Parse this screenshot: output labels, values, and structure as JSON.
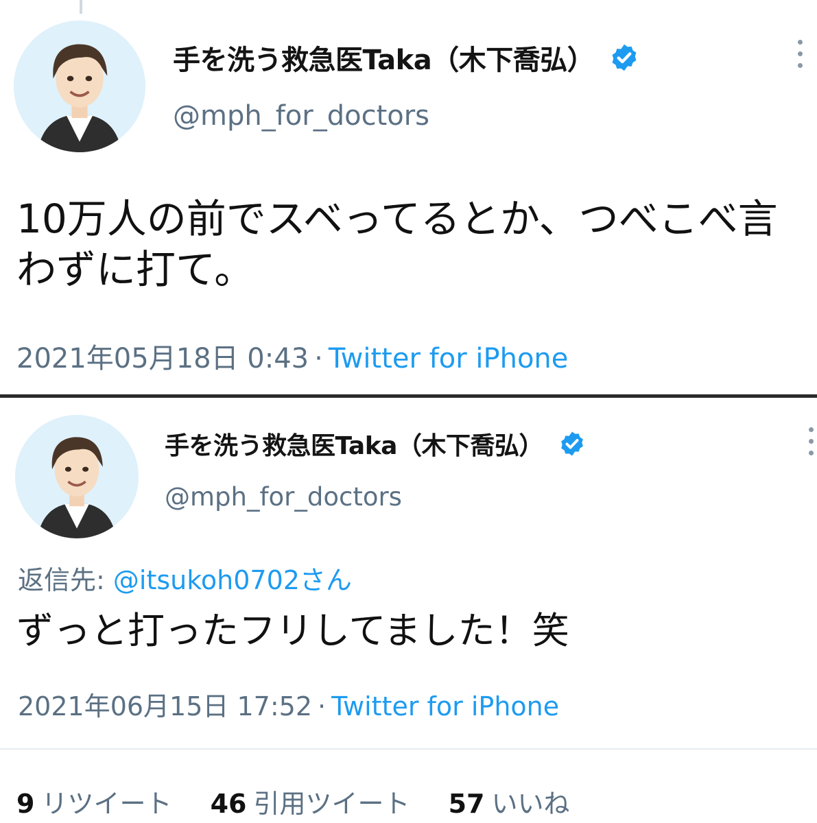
{
  "tweets": [
    {
      "display_name": "手を洗う救急医Taka（木下喬弘）",
      "handle": "@mph_for_doctors",
      "avatar_icon": "avatar-icon",
      "verified_icon": "verified-badge-icon",
      "more_icon": "more-options-icon",
      "text": "10万人の前でスベってるとか、つべこべ言わずに打て。",
      "timestamp": "2021年05月18日 0:43",
      "separator": "·",
      "source": "Twitter for iPhone"
    },
    {
      "display_name": "手を洗う救急医Taka（木下喬弘）",
      "handle": "@mph_for_doctors",
      "avatar_icon": "avatar-icon",
      "verified_icon": "verified-badge-icon",
      "more_icon": "more-options-icon",
      "reply_label": "返信先:",
      "reply_target": "@itsukoh0702さん",
      "text": "ずっと打ったフリしてました！笑",
      "timestamp": "2021年06月15日 17:52",
      "separator": "·",
      "source": "Twitter for iPhone",
      "stats": [
        {
          "count": "9",
          "label": "リツイート"
        },
        {
          "count": "46",
          "label": "引用ツイート"
        },
        {
          "count": "57",
          "label": "いいね"
        }
      ]
    }
  ],
  "colors": {
    "text": "#141414",
    "secondary": "#5b7083",
    "link": "#1d9bf0",
    "verified": "#1d9bf0",
    "avatar_background": "#dff1fb"
  }
}
